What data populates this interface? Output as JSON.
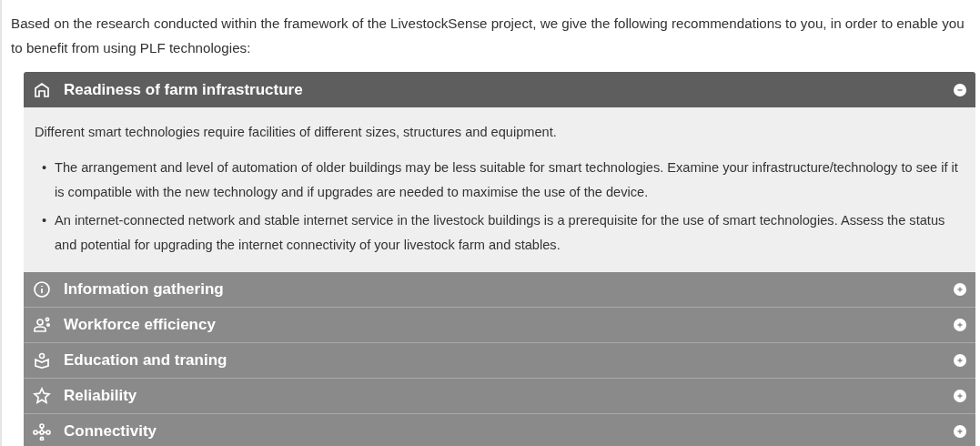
{
  "intro": "Based on the research conducted within the framework of the LivestockSense project, we give the following recommendations to you, in order to enable you to benefit from using PLF technologies:",
  "sections": [
    {
      "kind": "home",
      "title": "Readiness of farm infrastructure",
      "expanded": true,
      "lead": "Different smart technologies require facilities of different sizes, structures and equipment.",
      "bullets": [
        {
          "marker": "•",
          "text": "The arrangement and level of automation of older buildings may be less suitable for smart technologies. Examine your infrastructure/technology to see if it is compatible with the new technology and if upgrades are needed to maximise the use of the device."
        },
        {
          "marker": "•",
          "text": "An internet-connected network and stable internet service in the livestock buildings is a prerequisite for the use of smart technologies. Assess the status and potential for upgrading the internet connectivity of your livestock farm and stables."
        }
      ]
    },
    {
      "kind": "info",
      "title": "Information gathering",
      "expanded": false
    },
    {
      "kind": "people",
      "title": "Workforce efficiency",
      "expanded": false
    },
    {
      "kind": "education",
      "title": "Education and traning",
      "expanded": false
    },
    {
      "kind": "star",
      "title": "Reliability",
      "expanded": false
    },
    {
      "kind": "network",
      "title": "Connectivity",
      "expanded": false
    }
  ]
}
